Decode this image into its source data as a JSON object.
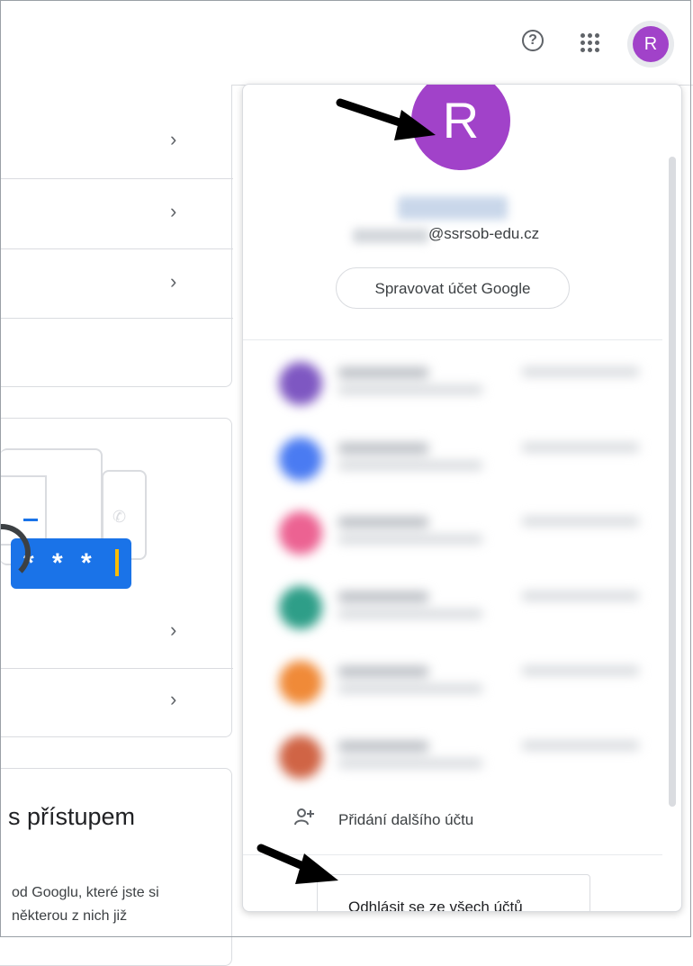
{
  "header": {
    "help_glyph": "?",
    "avatar_letter": "R",
    "icons": [
      "help-icon",
      "apps-icon",
      "avatar"
    ]
  },
  "left": {
    "card_bottom": {
      "heading": "s přístupem",
      "body": "od Googlu, které jste si některou z nich již"
    },
    "illustration": {
      "password_text": "* * *"
    }
  },
  "account_panel": {
    "avatar_letter": "R",
    "email_domain": "@ssrsob-edu.cz",
    "manage_button": "Spravovat účet Google",
    "add_account_label": "Přidání dalšího účtu",
    "sign_out_button": "Odhlásit se ze všech účtů",
    "other_accounts_colors": [
      "#7e57c2",
      "#4a7bf2",
      "#ec6292",
      "#2e9e88",
      "#f08a38",
      "#d06445"
    ]
  },
  "colors": {
    "avatar": "#a142c9",
    "accent": "#1a73e8"
  }
}
